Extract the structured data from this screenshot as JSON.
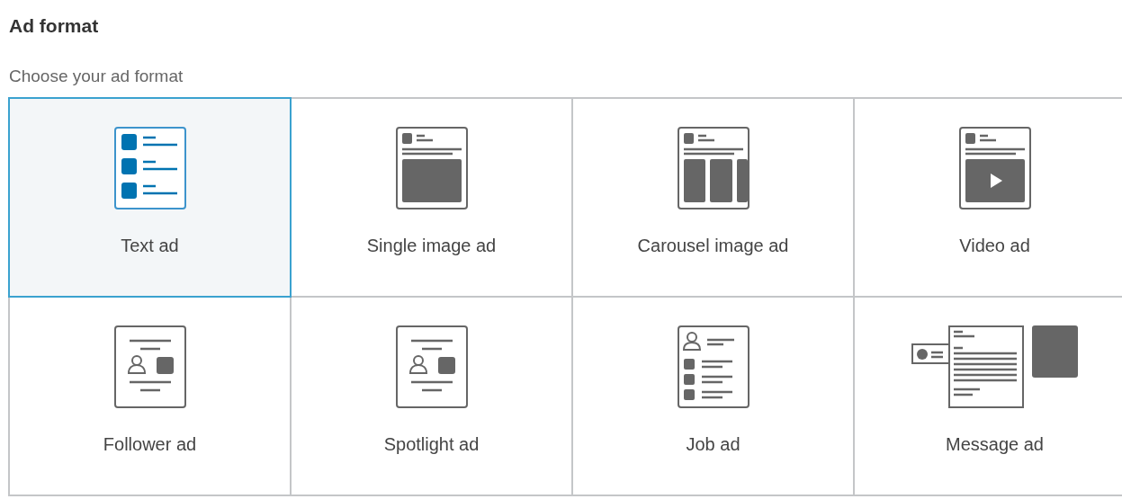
{
  "title": "Ad format",
  "subtitle": "Choose your ad format",
  "formats": [
    {
      "label": "Text ad",
      "kind": "text",
      "selected": true
    },
    {
      "label": "Single image ad",
      "kind": "single-image",
      "selected": false
    },
    {
      "label": "Carousel image ad",
      "kind": "carousel",
      "selected": false
    },
    {
      "label": "Video ad",
      "kind": "video",
      "selected": false
    },
    {
      "label": "Follower ad",
      "kind": "follower",
      "selected": false
    },
    {
      "label": "Spotlight ad",
      "kind": "spotlight",
      "selected": false
    },
    {
      "label": "Job ad",
      "kind": "job",
      "selected": false
    },
    {
      "label": "Message ad",
      "kind": "message",
      "selected": false
    }
  ]
}
